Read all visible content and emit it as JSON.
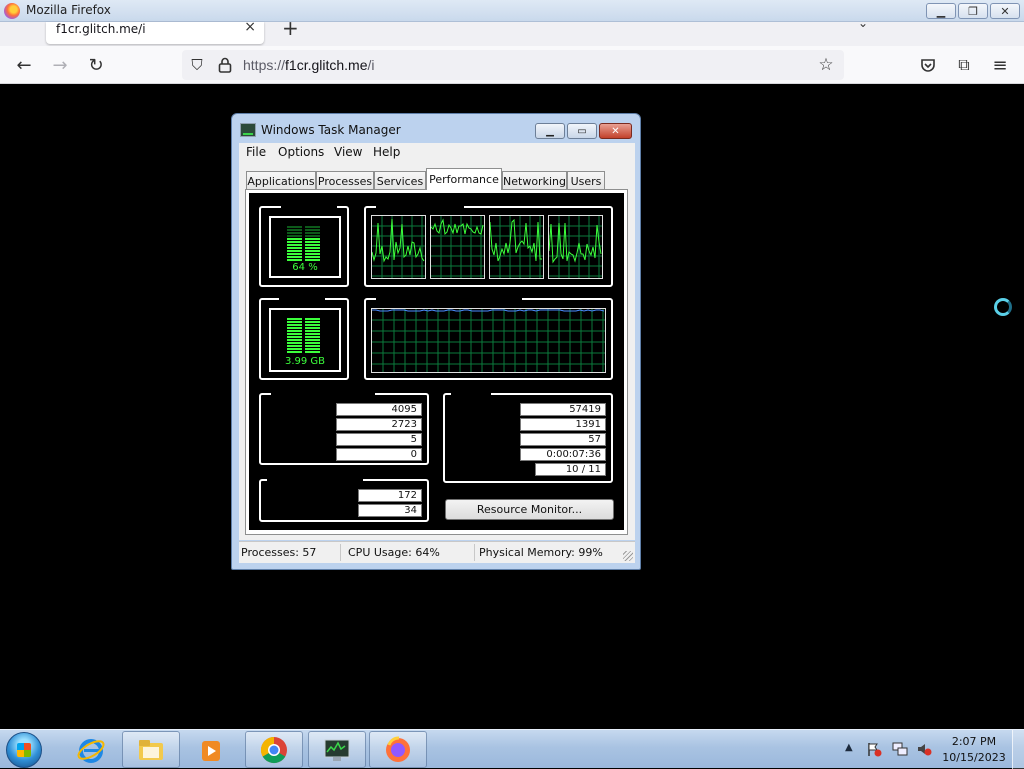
{
  "browser": {
    "window_title": "Mozilla Firefox",
    "tab_title": "f1cr.glitch.me/i",
    "url_prefix": "https://",
    "url_host": "f1cr.glitch.me",
    "url_path": "/i"
  },
  "task_manager": {
    "title": "Windows Task Manager",
    "menu": [
      "File",
      "Options",
      "View",
      "Help"
    ],
    "tabs": [
      "Applications",
      "Processes",
      "Services",
      "Performance",
      "Networking",
      "Users"
    ],
    "active_tab": "Performance",
    "cpu_usage_meter": "64 %",
    "memory_meter": "3.99 GB",
    "cpu_usage_fraction": 0.64,
    "physical_memory_fraction": 0.99,
    "physical_memory_values": [
      "4095",
      "2723",
      "5",
      "0"
    ],
    "system_values": [
      "57419",
      "1391",
      "57",
      "0:00:07:36",
      "10 / 11"
    ],
    "kernel_memory_values": [
      "172",
      "34"
    ],
    "resource_monitor_button": "Resource Monitor...",
    "status": {
      "processes": "Processes: 57",
      "cpu": "CPU Usage: 64%",
      "memory": "Physical Memory: 99%"
    },
    "colors": {
      "graph_line": "#3cff3c",
      "grid": "#0b7a3c",
      "memory_line": "#4a8cff"
    }
  },
  "taskbar": {
    "time": "2:07 PM",
    "date": "10/15/2023"
  }
}
